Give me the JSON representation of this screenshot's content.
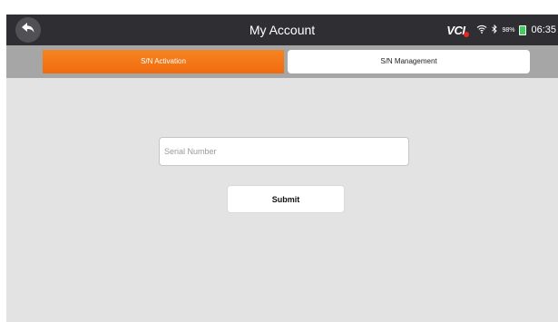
{
  "header": {
    "title": "My Account",
    "back_icon": "back-arrow-icon"
  },
  "status_bar": {
    "vci_label": "VCI",
    "vci_indicator_color": "#e8281e",
    "wifi_icon": "wifi-icon",
    "bluetooth_icon": "bluetooth-icon",
    "battery_percent": "98%",
    "battery_color": "#3fcf5b",
    "time": "06:35"
  },
  "tabs": [
    {
      "label": "S/N Activation",
      "active": true
    },
    {
      "label": "S/N Management",
      "active": false
    }
  ],
  "form": {
    "serial_placeholder": "Serial Number",
    "serial_value": "",
    "submit_label": "Submit"
  },
  "colors": {
    "accent": "#f47a18",
    "titlebar": "#2f2f33",
    "tabbar": "#a6a6a6",
    "content_bg": "#e3e3e3"
  }
}
